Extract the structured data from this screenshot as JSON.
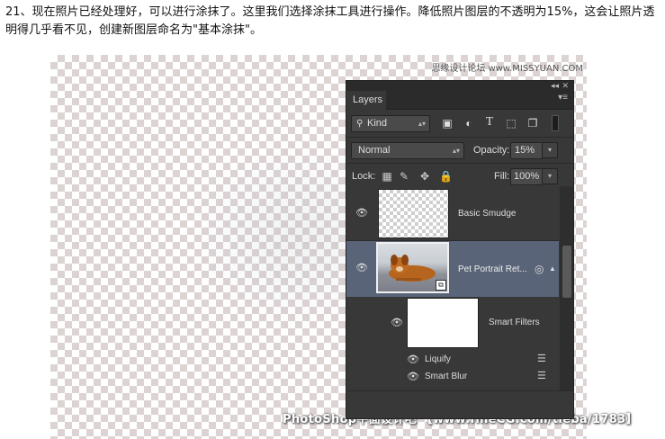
{
  "caption": "21、现在照片已经处理好，可以进行涂抹了。这里我们选择涂抹工具进行操作。降低照片图层的不透明为15%，这会让照片透明得几乎看不见，创建新图层命名为\"基本涂抹\"。",
  "watermark_top": "思缘设计论坛 www.MISSYUAN.COM",
  "watermark_bottom": "PhotoShop平面设计吧 【www.fineCG.com/tieba/1783】",
  "panel": {
    "tab": "Layers",
    "filter_kind": "Kind",
    "blend_mode": "Normal",
    "opacity_label": "Opacity:",
    "opacity_value": "15%",
    "lock_label": "Lock:",
    "fill_label": "Fill:",
    "fill_value": "100%",
    "layers": [
      {
        "name": "Basic Smudge"
      },
      {
        "name": "Pet Portrait Ret..."
      }
    ],
    "smart_filters": "Smart Filters",
    "filters": [
      "Liquify",
      "Smart Blur"
    ]
  }
}
